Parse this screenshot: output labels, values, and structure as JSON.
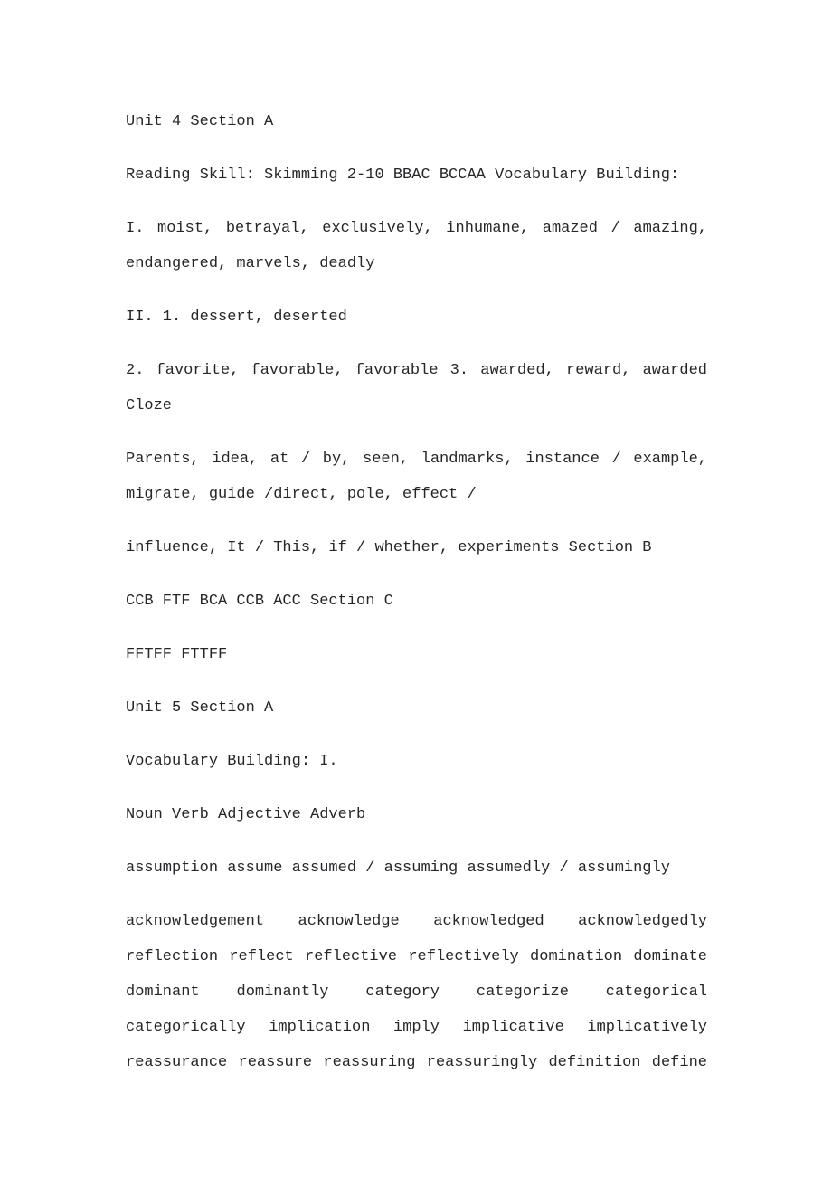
{
  "document": {
    "page_background": "#ffffff",
    "text_color": "#26262a",
    "paragraphs": [
      {
        "id": "unit4-heading",
        "name": "unit-4-section-a-heading",
        "text": "Unit 4 Section A",
        "justify_all_lines": false
      },
      {
        "id": "unit4-reading-skill",
        "name": "reading-skill-line",
        "text": "Reading Skill: Skimming 2-10 BBAC BCCAA Vocabulary Building:",
        "justify_all_lines": false
      },
      {
        "id": "unit4-vocab-1",
        "name": "vocabulary-answers-part-1",
        "text": "I. moist, betrayal, exclusively, inhumane, amazed / amazing, endangered, marvels, deadly",
        "justify_all_lines": false
      },
      {
        "id": "unit4-vocab-2a",
        "name": "vocabulary-answers-part-2-item-1",
        "text": "II. 1. dessert, deserted",
        "justify_all_lines": false
      },
      {
        "id": "unit4-vocab-2b",
        "name": "vocabulary-answers-part-2-items-2-3",
        "text": "2. favorite, favorable, favorable 3. awarded, reward, awarded Cloze",
        "justify_all_lines": false
      },
      {
        "id": "unit4-cloze-1",
        "name": "cloze-answers-part-1",
        "text": "Parents, idea, at / by, seen, landmarks, instance / example, migrate, guide /direct, pole, effect /",
        "justify_all_lines": false
      },
      {
        "id": "unit4-cloze-2",
        "name": "cloze-answers-part-2",
        "text": "influence, It / This, if / whether, experiments Section B",
        "justify_all_lines": false
      },
      {
        "id": "unit4-section-b",
        "name": "section-b-answers",
        "text": "CCB FTF BCA CCB ACC Section C",
        "justify_all_lines": false
      },
      {
        "id": "unit4-section-c",
        "name": "section-c-answers",
        "text": "FFTFF FTTFF",
        "justify_all_lines": false
      },
      {
        "id": "unit5-heading",
        "name": "unit-5-section-a-heading",
        "text": "Unit 5 Section A",
        "justify_all_lines": false
      },
      {
        "id": "unit5-vocab-heading",
        "name": "vocabulary-building-heading",
        "text": "Vocabulary Building: I.",
        "justify_all_lines": false
      },
      {
        "id": "unit5-table-header",
        "name": "word-form-column-headers",
        "text": "Noun Verb Adjective Adverb",
        "justify_all_lines": false
      },
      {
        "id": "unit5-row-assume",
        "name": "word-form-row-assume",
        "text": "assumption assume assumed / assuming assumedly / assumingly",
        "justify_all_lines": false
      },
      {
        "id": "unit5-rows-rest",
        "name": "word-form-rows-remaining",
        "text": "acknowledgement acknowledge acknowledged acknowledgedly reflection reflect reflective reflectively domination dominate dominant dominantly category categorize categorical categorically implication imply implicative implicatively reassurance reassure reassuring reassuringly definition define",
        "justify_all_lines": true
      }
    ]
  }
}
